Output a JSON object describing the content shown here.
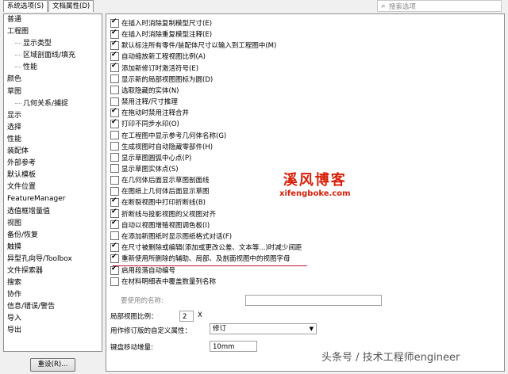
{
  "tabs": [
    "系统选项(S)",
    "文档属性(D)"
  ],
  "search": {
    "placeholder": "搜索选项"
  },
  "tree": [
    {
      "label": "普通",
      "level": 0
    },
    {
      "label": "工程图",
      "level": 0
    },
    {
      "label": "显示类型",
      "level": 1
    },
    {
      "label": "区域剖面线/填充",
      "level": 1
    },
    {
      "label": "性能",
      "level": 1
    },
    {
      "label": "颜色",
      "level": 0
    },
    {
      "label": "草图",
      "level": 0
    },
    {
      "label": "几何关系/捕捉",
      "level": 1
    },
    {
      "label": "显示",
      "level": 0
    },
    {
      "label": "选择",
      "level": 0
    },
    {
      "label": "性能",
      "level": 0
    },
    {
      "label": "装配体",
      "level": 0
    },
    {
      "label": "外部参考",
      "level": 0
    },
    {
      "label": "默认模板",
      "level": 0
    },
    {
      "label": "文件位置",
      "level": 0
    },
    {
      "label": "FeatureManager",
      "level": 0
    },
    {
      "label": "选值框增量值",
      "level": 0
    },
    {
      "label": "视图",
      "level": 0
    },
    {
      "label": "备份/恢复",
      "level": 0
    },
    {
      "label": "触摸",
      "level": 0
    },
    {
      "label": "异型孔向导/Toolbox",
      "level": 0
    },
    {
      "label": "文件探索器",
      "level": 0
    },
    {
      "label": "搜索",
      "level": 0
    },
    {
      "label": "协作",
      "level": 0
    },
    {
      "label": "信息/错误/警告",
      "level": 0
    },
    {
      "label": "导入",
      "level": 0
    },
    {
      "label": "导出",
      "level": 0
    }
  ],
  "reset_button": "重设(R)...",
  "options": [
    {
      "label": "在插入时消除复制模型尺寸(E)",
      "checked": true
    },
    {
      "label": "在插入时消除重复模型注释(E)",
      "checked": true
    },
    {
      "label": "默认标注所有零件/装配体尺寸以输入到工程图中(M)",
      "checked": true
    },
    {
      "label": "自动缩放新工程视图比例(A)",
      "checked": true
    },
    {
      "label": "添加新修订时激活符号(E)",
      "checked": true
    },
    {
      "label": "显示新的局部视图图标为圆(D)",
      "checked": false
    },
    {
      "label": "选取隐藏的实体(N)",
      "checked": false
    },
    {
      "label": "禁用注释/尺寸推理",
      "checked": false
    },
    {
      "label": "在拖动时禁用注释合并",
      "checked": true
    },
    {
      "label": "打印不同步水印(O)",
      "checked": true
    },
    {
      "label": "在工程图中显示参考几何体名称(G)",
      "checked": false
    },
    {
      "label": "生成视图时自动隐藏零部件(H)",
      "checked": false
    },
    {
      "label": "显示草图圆弧中心点(P)",
      "checked": false
    },
    {
      "label": "显示草图实体点(S)",
      "checked": false
    },
    {
      "label": "在几何体后面显示草图剖面线",
      "checked": false
    },
    {
      "label": "在图纸上几何体后面显示草图",
      "checked": false
    },
    {
      "label": "在断裂视图中打印折断线(B)",
      "checked": true
    },
    {
      "label": "折断线与投影视图的父视图对齐",
      "checked": true
    },
    {
      "label": "自动以视图增殖视图调色板(I)",
      "checked": true
    },
    {
      "label": "在添加新图纸时显示图纸格式对话(F)",
      "checked": false
    },
    {
      "label": "在尺寸被删除或编辑(添加或更改公差、文本等...)时减少间距",
      "checked": true
    },
    {
      "label": "重新使用所删除的辅助、局部、及剖面视图中的视图字母",
      "checked": true
    },
    {
      "label": "启用段落自动编号",
      "checked": true
    },
    {
      "label": "在材料明细表中覆盖数量列名称",
      "checked": false
    }
  ],
  "fields": {
    "qty_name_label": "要使用的名称:",
    "qty_name_value": "",
    "detail_scale_label": "局部视图比例：",
    "detail_scale_value": "2",
    "detail_scale_unit": "X",
    "custom_property_label": "用作修订版的自定义属性：",
    "custom_property_value": "修订",
    "keyboard_step_label": "键盘移动增量:",
    "keyboard_step_value": "10mm"
  },
  "watermark": {
    "title": "溪风博客",
    "url": "xifengboke.com"
  },
  "footer": "头条号 / 技术工程师engineer",
  "colors": {
    "highlight": "#c8102e",
    "watermark": "#d81e06"
  }
}
